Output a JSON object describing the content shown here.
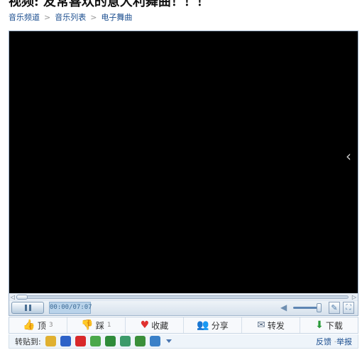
{
  "page": {
    "title": "视频: 友常喜欢的意大利舞曲！！！"
  },
  "breadcrumb": [
    "音乐频道",
    "音乐列表",
    "电子舞曲"
  ],
  "player": {
    "time": "00:00/07:07",
    "progress": 0,
    "volume": 0.85,
    "side_arrow": "chevron-left-icon"
  },
  "actions": [
    {
      "label": "顶",
      "count": "3",
      "icon": "thumbs-up-icon"
    },
    {
      "label": "踩",
      "count": "1",
      "icon": "thumbs-down-icon"
    },
    {
      "label": "收藏",
      "count": "",
      "icon": "heart-icon"
    },
    {
      "label": "分享",
      "count": "",
      "icon": "users-icon"
    },
    {
      "label": "转发",
      "count": "",
      "icon": "forward-icon"
    },
    {
      "label": "下载",
      "count": "",
      "icon": "download-icon"
    }
  ],
  "share": {
    "label": "转贴到:",
    "sites": [
      {
        "name": "qzone-icon",
        "color": "#e0b030"
      },
      {
        "name": "baidu-icon",
        "color": "#2d62c8"
      },
      {
        "name": "weibo-icon",
        "color": "#d8282a"
      },
      {
        "name": "frog-icon",
        "color": "#4aa84a"
      },
      {
        "name": "clover-icon",
        "color": "#2e8b3a"
      },
      {
        "name": "people-icon",
        "color": "#3c9a6a"
      },
      {
        "name": "kaixin-icon",
        "color": "#3a8f3a"
      },
      {
        "name": "qq-icon",
        "color": "#3a80c8"
      }
    ],
    "feedback": "反馈",
    "report": "举报"
  }
}
